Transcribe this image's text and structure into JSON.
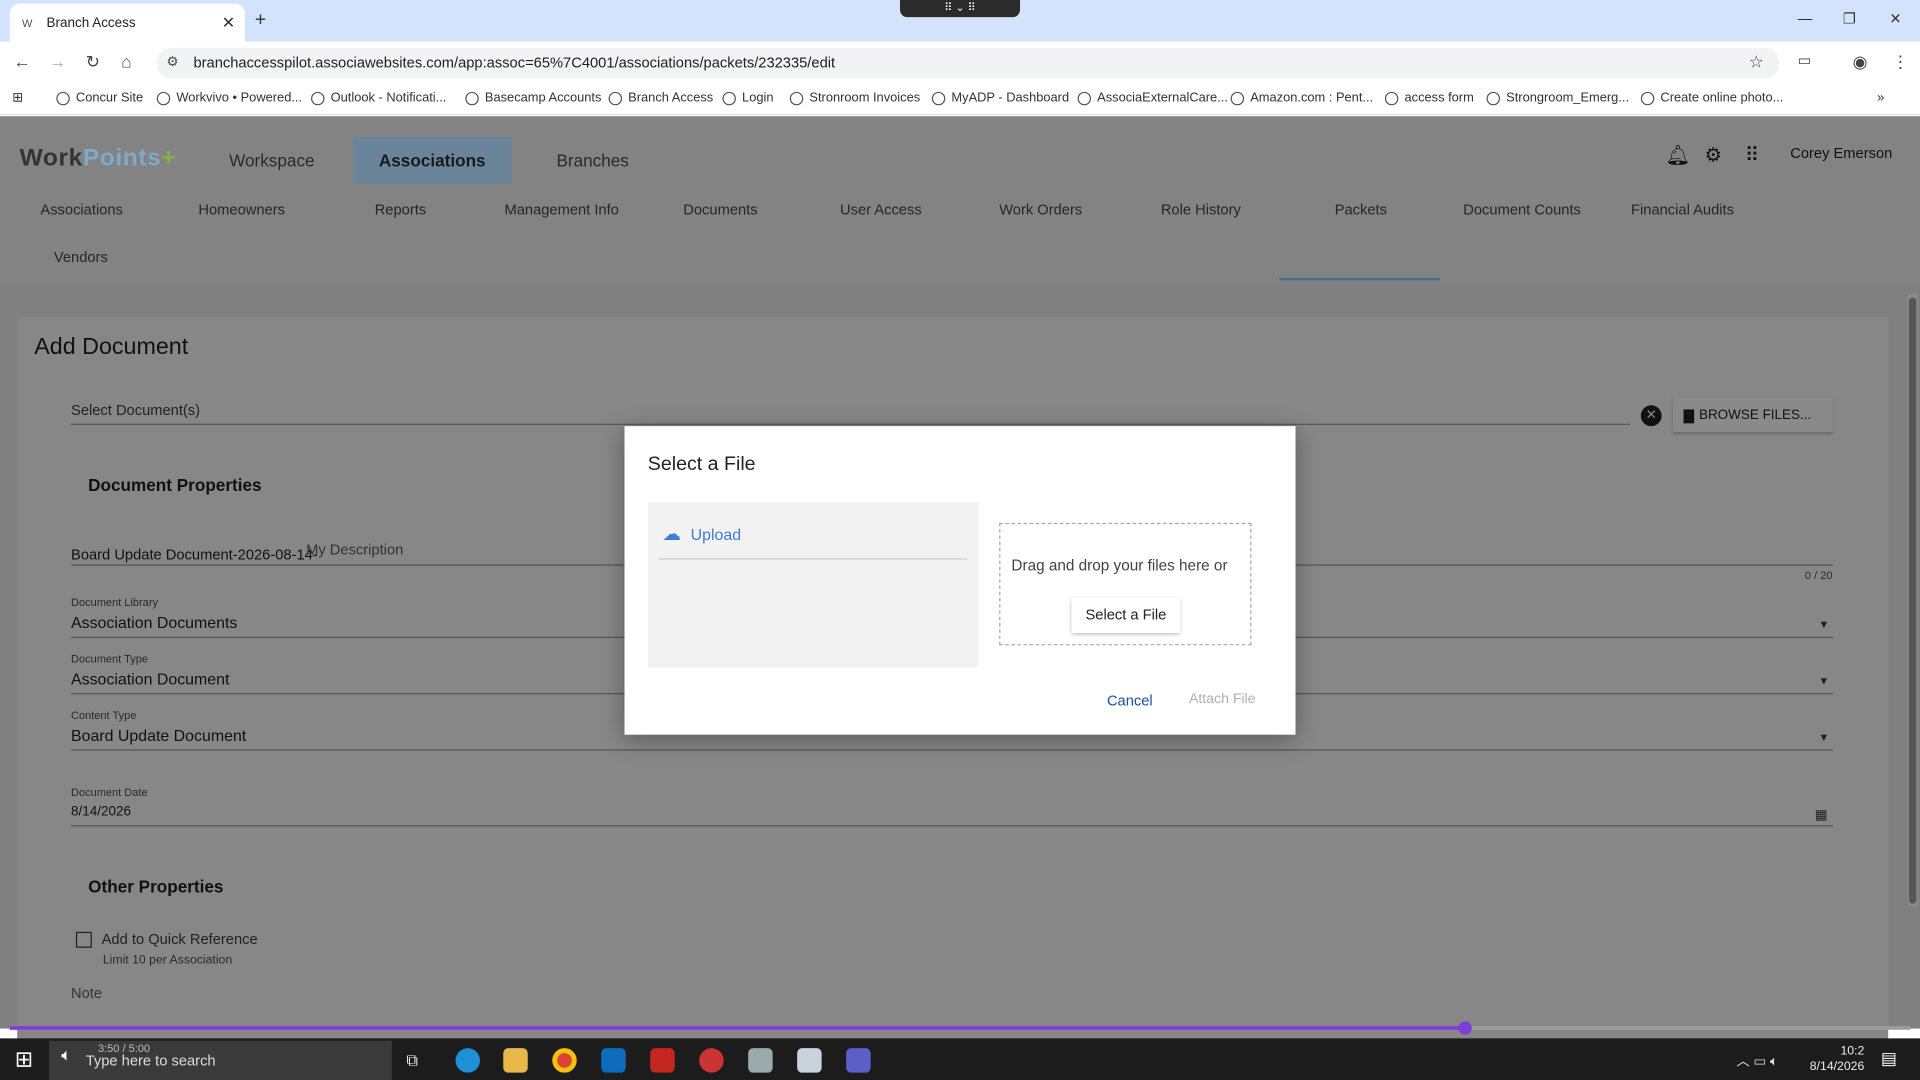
{
  "browser": {
    "tab_title": "Branch Access",
    "tab_favicon": "W",
    "url": "branchaccesspilot.associawebsites.com/app:assoc=65%7C4001/associations/packets/232335/edit",
    "bookmarks": [
      "Concur Site",
      "Workvivo • Powered...",
      "Outlook - Notificati...",
      "Basecamp Accounts",
      "Branch Access",
      "Login",
      "Stronroom Invoices",
      "MyADP - Dashboard",
      "AssociaExternalCare...",
      "Amazon.com : Pent...",
      "access form",
      "Strongroom_Emerg...",
      "Create online photo..."
    ]
  },
  "app": {
    "logo_a": "Work",
    "logo_b": "Points",
    "logo_c": "+",
    "top_nav": [
      "Workspace",
      "Associations",
      "Branches"
    ],
    "user": "Corey Emerson",
    "sub_nav": [
      "Associations",
      "Homeowners",
      "Reports",
      "Management Info",
      "Documents",
      "User Access",
      "Work Orders",
      "Role History",
      "Packets",
      "Document Counts",
      "Financial Audits",
      "Vendors"
    ]
  },
  "page": {
    "title": "Add Document",
    "select_docs": "Select Document(s)",
    "browse": "BROWSE FILES...",
    "doc_props": "Document Properties",
    "doc_name_prefix": "Board Update Document-2026-08-14-",
    "desc_placeholder": "My Description",
    "char_count": "0 / 20",
    "library_label": "Document Library",
    "library_value": "Association Documents",
    "type_label": "Document Type",
    "type_value": "Association Document",
    "content_label": "Content Type",
    "content_value": "Board Update Document",
    "date_label": "Document Date",
    "date_value": "8/14/2026",
    "other_props": "Other Properties",
    "quick_ref": "Add to Quick Reference",
    "quick_ref_hint": "Limit 10 per Association",
    "note": "Note"
  },
  "modal": {
    "title": "Select a File",
    "upload": "Upload",
    "drop_text": "Drag and drop your files here or",
    "select_btn": "Select a File",
    "cancel": "Cancel",
    "attach": "Attach File"
  },
  "video": {
    "time": "3:50 / 5:00",
    "progress": 0.766
  },
  "taskbar": {
    "search": "Type here to search",
    "time": "10:2",
    "date": "8/14/2026"
  }
}
